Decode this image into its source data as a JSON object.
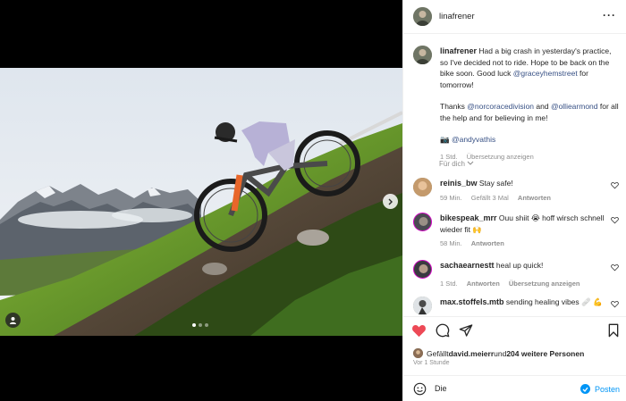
{
  "post": {
    "author": "linafrener",
    "caption": {
      "username": "linafrener",
      "text_1": " Had a big crash in yesterday's practice, so I've decided not to ride. Hope to be back on the bike soon. Good luck ",
      "mention_1": "@graceyhemstreet",
      "text_2": " for tomorrow!",
      "text_3": "Thanks ",
      "mention_2": "@norcoracedivision",
      "text_4": " and ",
      "mention_3": "@olliearmond",
      "text_5": " for all the help and for believing in me!",
      "camera": "📷",
      "mention_4": "@andyvathis",
      "time": "1 Std.",
      "translate": "Übersetzung anzeigen"
    },
    "more_like_this": "Für dich"
  },
  "comments": [
    {
      "username": "reinis_bw",
      "text": "Stay safe!",
      "time": "59 Min.",
      "likes": "Gefällt 3 Mal",
      "reply": "Antworten"
    },
    {
      "username": "bikespeak_mrr",
      "text": "Ouu shiit 😭 hoff wirsch schnell wieder fit 🙌",
      "time": "58 Min.",
      "reply": "Antworten"
    },
    {
      "username": "sachaearnestt",
      "text": "heal up quick!",
      "time": "1 Std.",
      "reply": "Antworten",
      "translate": "Übersetzung anzeigen"
    },
    {
      "username": "max.stoffels.mtb",
      "text": "sending healing vibes 🩹 💪"
    }
  ],
  "likes": {
    "prefix": "Gefällt ",
    "user": "david.meierr",
    "middle": " und ",
    "others": "204 weitere Personen",
    "time": "Vor 1 Stunde"
  },
  "composer": {
    "placeholder": "Die",
    "post_label": "Posten"
  },
  "colors": {
    "liked_heart": "#ed4956",
    "link": "#385185",
    "post_button": "#0095f6"
  },
  "icons": [
    "more-icon",
    "heart-icon",
    "comment-icon",
    "share-icon",
    "bookmark-icon",
    "emoji-icon",
    "chevron-right-icon",
    "user-tag-icon",
    "chevron-down-icon"
  ],
  "carousel": {
    "slides": 3,
    "active": 1
  }
}
